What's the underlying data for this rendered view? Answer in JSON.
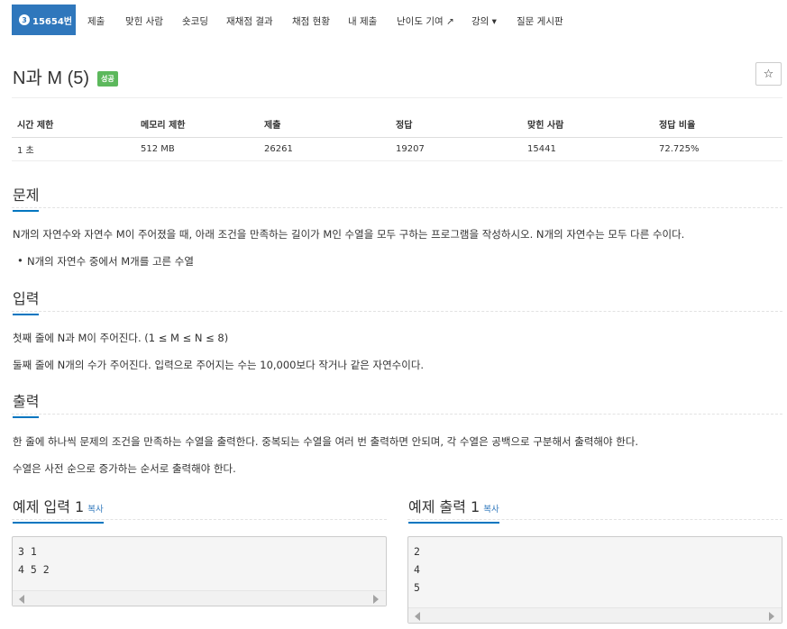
{
  "nav": {
    "active_badge": "3",
    "active_label": "15654번",
    "items": [
      "제출",
      "맞힌 사람",
      "숏코딩",
      "재채점 결과",
      "채점 현황",
      "내 제출",
      "난이도 기여",
      "강의",
      "질문 게시판"
    ]
  },
  "problem": {
    "title": "N과 M (5)",
    "status": "성공",
    "star": "☆"
  },
  "info": {
    "headers": [
      "시간 제한",
      "메모리 제한",
      "제출",
      "정답",
      "맞힌 사람",
      "정답 비율"
    ],
    "values": [
      "1 초",
      "512 MB",
      "26261",
      "19207",
      "15441",
      "72.725%"
    ]
  },
  "sections": {
    "problem_head": "문제",
    "problem_text": "N개의 자연수와 자연수 M이 주어졌을 때, 아래 조건을 만족하는 길이가 M인 수열을 모두 구하는 프로그램을 작성하시오. N개의 자연수는 모두 다른 수이다.",
    "problem_bullet": "N개의 자연수 중에서 M개를 고른 수열",
    "input_head": "입력",
    "input_line1": "첫째 줄에 N과 M이 주어진다. (1 ≤ M ≤ N ≤ 8)",
    "input_line2": "둘째 줄에 N개의 수가 주어진다. 입력으로 주어지는 수는 10,000보다 작거나 같은 자연수이다.",
    "output_head": "출력",
    "output_line1": "한 줄에 하나씩 문제의 조건을 만족하는 수열을 출력한다. 중복되는 수열을 여러 번 출력하면 안되며, 각 수열은 공백으로 구분해서 출력해야 한다.",
    "output_line2": "수열은 사전 순으로 증가하는 순서로 출력해야 한다."
  },
  "samples": {
    "input_head": "예제 입력 1",
    "output_head": "예제 출력 1",
    "copy_label": "복사",
    "input_lines": [
      "3 1",
      "4 5 2"
    ],
    "output_lines": [
      "2",
      "4",
      "5"
    ]
  },
  "colors": {
    "nav_active": "#2f77bc",
    "success": "#5cb85c",
    "section_underline": "#0076c0"
  }
}
